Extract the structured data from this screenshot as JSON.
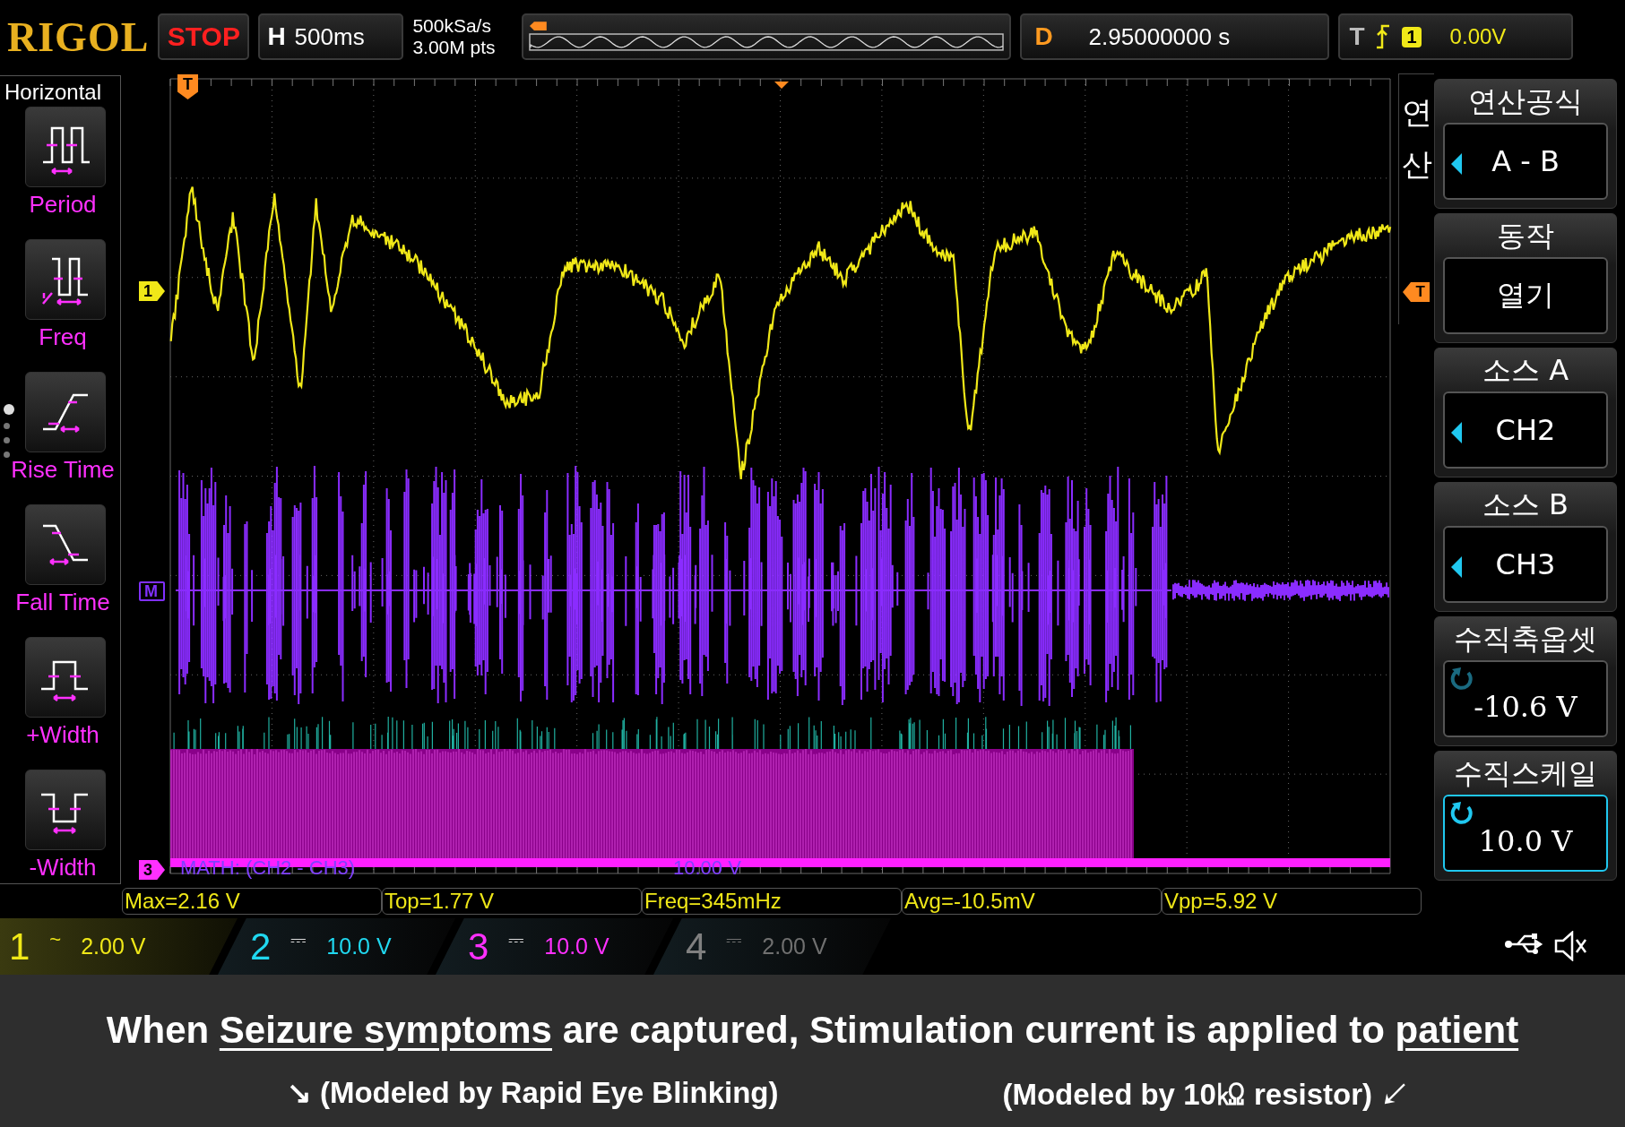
{
  "top_bar": {
    "brand": "RIGOL",
    "run_state": "STOP",
    "horizontal": {
      "label": "H",
      "timebase": "500ms"
    },
    "sample_rate": "500kSa/s",
    "memory_depth": "3.00M pts",
    "delay": {
      "label": "D",
      "value": "2.95000000 s"
    },
    "trigger": {
      "label": "T",
      "source": "1",
      "level": "0.00V"
    }
  },
  "left_menu": {
    "title": "Horizontal",
    "items": [
      {
        "kind": "period",
        "label": "Period"
      },
      {
        "kind": "freq",
        "label": "Freq"
      },
      {
        "kind": "rise",
        "label": "Rise Time"
      },
      {
        "kind": "fall",
        "label": "Fall Time"
      },
      {
        "kind": "pwidth",
        "label": "+Width"
      },
      {
        "kind": "nwidth",
        "label": "-Width"
      }
    ],
    "pages": [
      {
        "selected": true
      },
      {
        "selected": false
      },
      {
        "selected": false
      },
      {
        "selected": false
      }
    ]
  },
  "screen": {
    "markers": [
      {
        "kind": "channel",
        "label": "1"
      },
      {
        "kind": "math",
        "label": "M"
      },
      {
        "kind": "ref",
        "label": "3"
      },
      {
        "kind": "trigger",
        "label": "T"
      }
    ],
    "math_label": "MATH: (CH2 - CH3)",
    "math_scale": "10.00 V"
  },
  "right_menu": {
    "title": "연산",
    "trigger_marker": "T",
    "items": [
      {
        "kind": "select",
        "label": "연산공식",
        "value": "A - B",
        "selected": false
      },
      {
        "kind": "plain",
        "label": "동작",
        "value": "열기",
        "selected": false
      },
      {
        "kind": "select",
        "label": "소스 A",
        "value": "CH2",
        "selected": false
      },
      {
        "kind": "select",
        "label": "소스 B",
        "value": "CH3",
        "selected": false
      },
      {
        "kind": "knob",
        "label": "수직축옵셋",
        "value": "-10.6 V",
        "selected": false
      },
      {
        "kind": "knob",
        "label": "수직스케일",
        "value": "10.0 V",
        "selected": true
      }
    ]
  },
  "measurements": [
    "Max=2.16 V",
    "Top=1.77 V",
    "Freq=345mHz",
    "Avg=-10.5mV",
    "Vpp=5.92 V"
  ],
  "channels": [
    {
      "number": "1",
      "coupling": "~",
      "scale": "2.00 V",
      "color": "#f0e818",
      "on": true
    },
    {
      "number": "2",
      "coupling": "⎓",
      "scale": "10.0 V",
      "color": "#20d8f0",
      "on": true
    },
    {
      "number": "3",
      "coupling": "⎓",
      "scale": "10.0 V",
      "color": "#ff30ff",
      "on": true
    },
    {
      "number": "4",
      "coupling": "⎓",
      "scale": "2.00 V",
      "color": "#808080",
      "on": false
    }
  ],
  "caption": {
    "line": [
      {
        "text": "When ",
        "underline": false
      },
      {
        "text": "Seizure symptoms",
        "underline": true
      },
      {
        "text": " are captured, Stimulation current is applied to ",
        "underline": false
      },
      {
        "text": "patient",
        "underline": true
      }
    ],
    "notes": [
      "↘ (Modeled by Rapid Eye Blinking)",
      "(Modeled by 10㏀ resistor) ↙"
    ]
  }
}
